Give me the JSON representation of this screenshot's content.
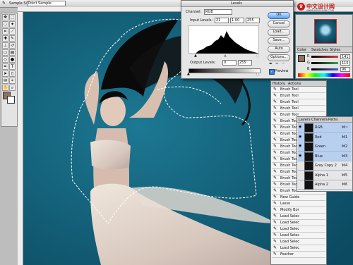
{
  "options_bar": {
    "sample_size_label": "Sample Size:",
    "sample_size_value": "Point Sample"
  },
  "levels_dialog": {
    "title": "Levels",
    "channel_label": "Channel:",
    "channel_value": "RGB",
    "input_levels_label": "Input Levels:",
    "input_values": [
      "21",
      "1.00",
      "255"
    ],
    "output_levels_label": "Output Levels:",
    "output_values": [
      "0",
      "255"
    ],
    "buttons": [
      "OK",
      "Cancel",
      "Load...",
      "Save...",
      "Auto",
      "Options..."
    ],
    "preview_label": "Preview",
    "preview_checked": true
  },
  "color_panel": {
    "tabs": [
      "Color",
      "Swatches",
      "Styles"
    ],
    "sliders": [
      {
        "label": "R",
        "value": "141",
        "color": "#d04040"
      },
      {
        "label": "G",
        "value": "115",
        "color": "#40a040"
      },
      {
        "label": "B",
        "value": "96",
        "color": "#4060d0"
      }
    ]
  },
  "history_panel": {
    "tabs": [
      "History",
      "Actions"
    ],
    "items": [
      "Brush Tool",
      "Brush Tool",
      "Brush Tool",
      "Brush Tool",
      "Brush Tool",
      "Brush Tool",
      "Brush Tool",
      "Brush Tool",
      "Brush Tool",
      "Brush Tool",
      "Brush Tool",
      "Brush Tool",
      "Brush Tool",
      "Brush Tool",
      "Brush Tool",
      "Brush Tool",
      "Brush Tool",
      "New Guide",
      "Lasso",
      "Modify Bor",
      "Load Selec",
      "Load Selec",
      "Load Selec",
      "Load Selec",
      "Load Selec",
      "Load Selec",
      "Feather"
    ]
  },
  "channels_panel": {
    "tabs": [
      "Layers",
      "Channels",
      "Paths"
    ],
    "rows": [
      {
        "name": "RGB",
        "shortcut": "⌘~",
        "selected": true
      },
      {
        "name": "Red",
        "shortcut": "⌘1",
        "selected": true
      },
      {
        "name": "Green",
        "shortcut": "⌘2",
        "selected": true
      },
      {
        "name": "Blue",
        "shortcut": "⌘3",
        "selected": true
      },
      {
        "name": "Grey Copy 2",
        "shortcut": "⌘4",
        "selected": false
      },
      {
        "name": "Alpha 1",
        "shortcut": "⌘5",
        "selected": false
      },
      {
        "name": "Alpha 2",
        "shortcut": "⌘6",
        "selected": false
      }
    ]
  },
  "watermark": {
    "text": "中文设计网",
    "sub": "WWW.MISSYUAN.COM"
  },
  "colors": {
    "canvas_bg": "#14627c",
    "accent": "#3a7fd8"
  }
}
